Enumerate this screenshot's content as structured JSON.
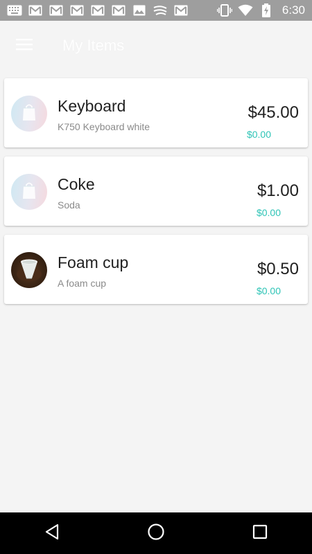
{
  "status_bar": {
    "time": "6:30",
    "icons": [
      "keyboard-icon",
      "gmail-icon",
      "gmail-icon",
      "gmail-icon",
      "gmail-icon",
      "gmail-icon",
      "image-icon",
      "swiftkey-icon",
      "gmail-icon",
      "vibrate-icon",
      "wifi-icon",
      "battery-charging-icon"
    ]
  },
  "app_bar": {
    "title": "My Items",
    "menu_icon": "hamburger-menu-icon"
  },
  "colors": {
    "accent": "#2ec4b6",
    "background": "#f4f4f4",
    "status_bar": "#9e9e9e",
    "nav_bar": "#000000"
  },
  "items": [
    {
      "name": "Keyboard",
      "description": "K750 Keyboard white",
      "price": "$45.00",
      "sub_price": "$0.00",
      "image": "shopping-bag-placeholder-icon"
    },
    {
      "name": "Coke",
      "description": "Soda",
      "price": "$1.00",
      "sub_price": "$0.00",
      "image": "shopping-bag-placeholder-icon"
    },
    {
      "name": "Foam cup",
      "description": "A foam cup",
      "price": "$0.50",
      "sub_price": "$0.00",
      "image": "foam-cup-photo"
    }
  ],
  "nav_bar": {
    "icons": [
      "back-icon",
      "home-icon",
      "recents-icon"
    ]
  }
}
